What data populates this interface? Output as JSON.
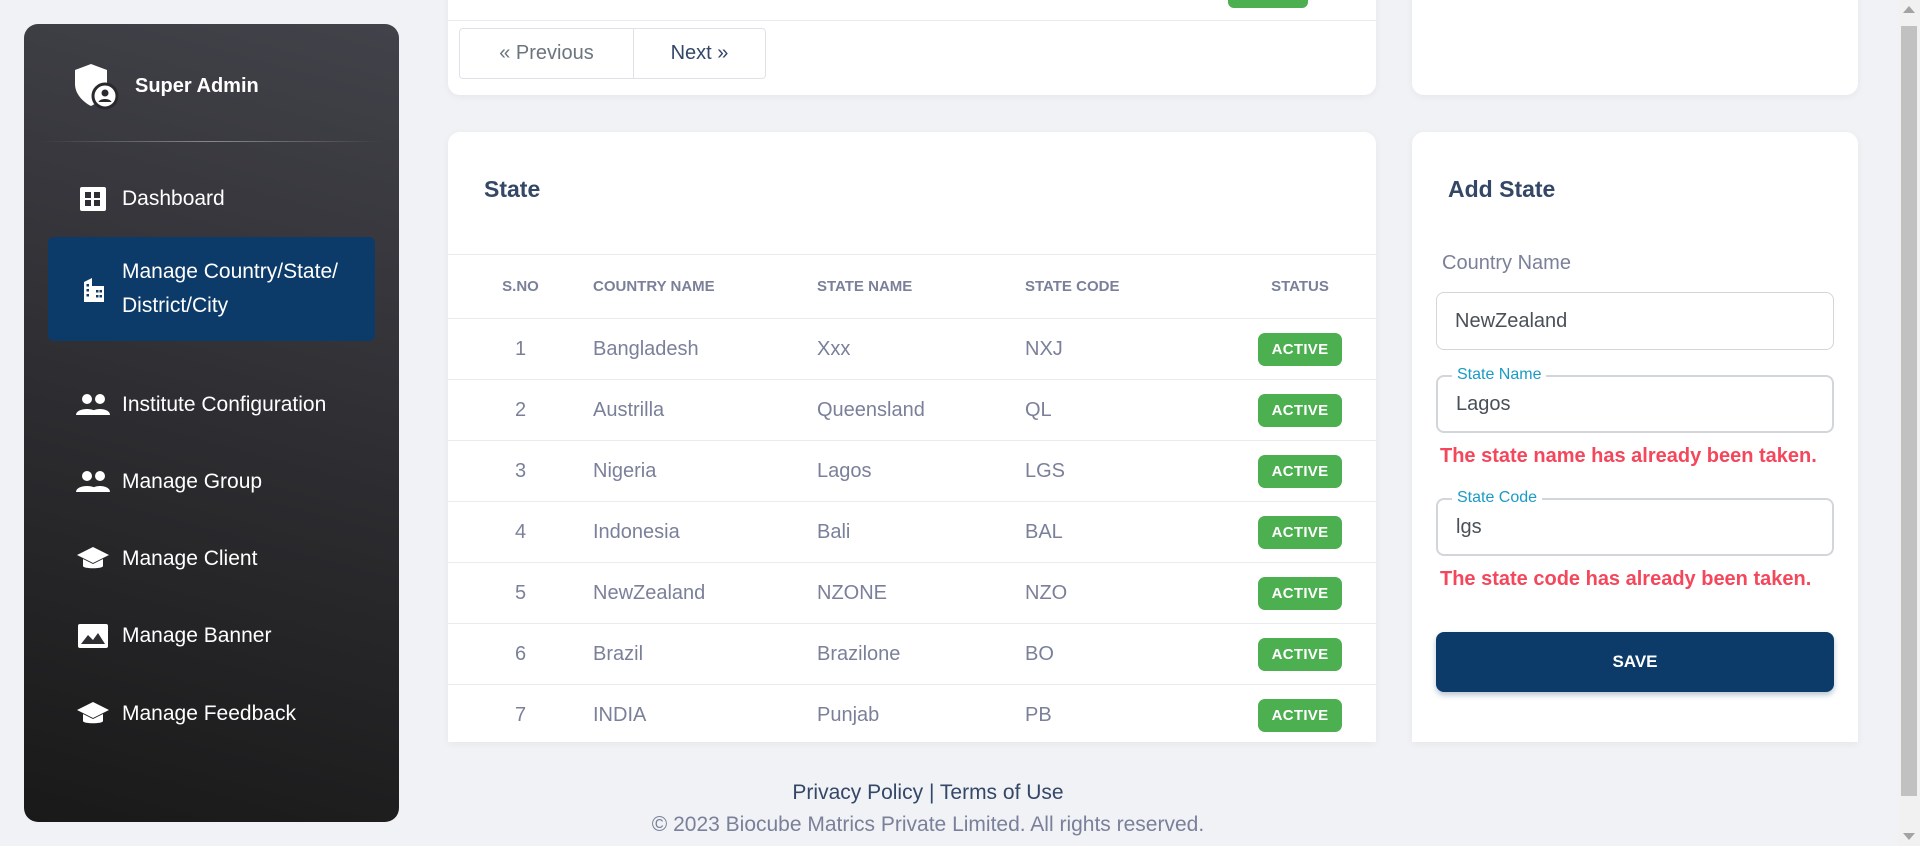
{
  "sidebar": {
    "brand": "Super Admin",
    "items": [
      {
        "label": "Dashboard",
        "icon": "dashboard-icon"
      },
      {
        "label_line1": "Manage Country/State/",
        "label_line2": "District/City",
        "icon": "apartment-icon",
        "active": true
      },
      {
        "label": "Institute Configuration",
        "icon": "people-icon"
      },
      {
        "label": "Manage Group",
        "icon": "people-icon"
      },
      {
        "label": "Manage Client",
        "icon": "school-icon"
      },
      {
        "label": "Manage Banner",
        "icon": "image-icon"
      },
      {
        "label": "Manage Feedback",
        "icon": "school-icon"
      }
    ]
  },
  "pager": {
    "previous": "« Previous",
    "next": "Next »"
  },
  "state_table": {
    "title": "State",
    "columns": [
      "S.NO",
      "COUNTRY NAME",
      "STATE NAME",
      "STATE CODE",
      "STATUS"
    ],
    "rows": [
      {
        "sno": "1",
        "country": "Bangladesh",
        "state": "Xxx",
        "code": "NXJ",
        "status": "ACTIVE"
      },
      {
        "sno": "2",
        "country": "Austrilla",
        "state": "Queensland",
        "code": "QL",
        "status": "ACTIVE"
      },
      {
        "sno": "3",
        "country": "Nigeria",
        "state": "Lagos",
        "code": "LGS",
        "status": "ACTIVE"
      },
      {
        "sno": "4",
        "country": "Indonesia",
        "state": "Bali",
        "code": "BAL",
        "status": "ACTIVE"
      },
      {
        "sno": "5",
        "country": "NewZealand",
        "state": "NZONE",
        "code": "NZO",
        "status": "ACTIVE"
      },
      {
        "sno": "6",
        "country": "Brazil",
        "state": "Brazilone",
        "code": "BO",
        "status": "ACTIVE"
      },
      {
        "sno": "7",
        "country": "INDIA",
        "state": "Punjab",
        "code": "PB",
        "status": "ACTIVE"
      }
    ]
  },
  "add_state": {
    "title": "Add State",
    "country_label": "Country Name",
    "country_value": "NewZealand",
    "state_name_label": "State Name",
    "state_name_value": "Lagos",
    "state_name_error": "The state name has already been taken.",
    "state_code_label": "State Code",
    "state_code_value": "lgs",
    "state_code_error": "The state code has already been taken.",
    "save": "SAVE"
  },
  "footer": {
    "privacy": "Privacy Policy",
    "separator": "|",
    "terms": "Terms of Use",
    "copyright": "© 2023 Biocube Matrics Private Limited. All rights reserved."
  },
  "colors": {
    "primary": "#0d3b69",
    "success": "#4caf50",
    "error": "#f4475b",
    "sidebar_dark": "#191919"
  }
}
